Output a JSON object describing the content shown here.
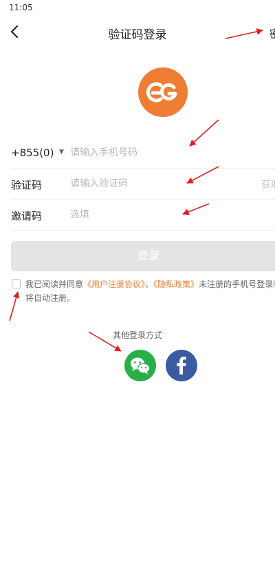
{
  "status_bar": {
    "time": "11:05"
  },
  "header": {
    "title": "验证码登录",
    "right_action_partial": "密"
  },
  "logo": {
    "icon": "cg-logo-icon",
    "color": "#ef7d33"
  },
  "form": {
    "phone": {
      "country_code": "+855(0)",
      "placeholder": "请输入手机号码"
    },
    "code": {
      "label": "验证码",
      "placeholder": "请输入验证码",
      "get_code_partial": "获取"
    },
    "invite": {
      "label": "邀请码",
      "placeholder": "选填"
    }
  },
  "login_button": {
    "label": "登录"
  },
  "agreement": {
    "prefix": "我已阅读并同意",
    "user_agreement": "《用户注册协议》",
    "separator": "、",
    "privacy_policy": "《隐私政策》",
    "suffix": "未注册的手机号登录时将自动注册。"
  },
  "other_login": {
    "label": "其他登录方式",
    "options": [
      {
        "name": "wechat",
        "icon": "wechat-icon",
        "color": "#2aae47"
      },
      {
        "name": "facebook",
        "icon": "facebook-icon",
        "color": "#3b5ba1"
      }
    ]
  },
  "colors": {
    "accent": "#ef7d33",
    "annotation_arrows": "#e02020",
    "button_disabled": "#e4e4e4"
  }
}
